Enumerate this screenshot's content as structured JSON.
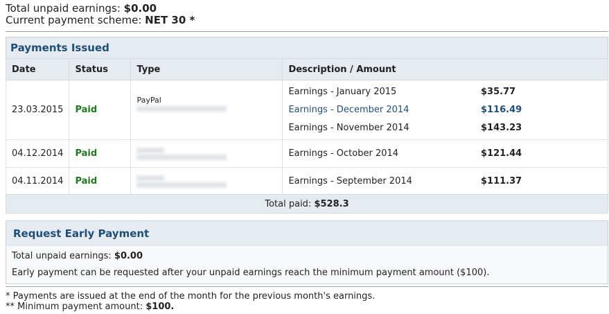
{
  "summary": {
    "unpaid_label": "Total unpaid earnings:",
    "unpaid_value": "$0.00",
    "scheme_label": "Current payment scheme:",
    "scheme_value": "NET 30 *"
  },
  "payments_issued": {
    "title": "Payments Issued",
    "columns": [
      "Date",
      "Status",
      "Type",
      "Description / Amount"
    ],
    "rows": [
      {
        "date": "23.03.2015",
        "status": "Paid",
        "type": "PayPal",
        "items": [
          {
            "desc": "Earnings - January 2015",
            "amount": "$35.77"
          },
          {
            "desc": "Earnings - December 2014",
            "amount": "$116.49"
          },
          {
            "desc": "Earnings - November 2014",
            "amount": "$143.23"
          }
        ]
      },
      {
        "date": "04.12.2014",
        "status": "Paid",
        "type": "",
        "items": [
          {
            "desc": "Earnings - October 2014",
            "amount": "$121.44"
          }
        ]
      },
      {
        "date": "04.11.2014",
        "status": "Paid",
        "type": "",
        "items": [
          {
            "desc": "Earnings - September 2014",
            "amount": "$111.37"
          }
        ]
      }
    ],
    "total_label": "Total paid:",
    "total_value": "$528.3"
  },
  "early_payment": {
    "title": "Request Early Payment",
    "unpaid_label": "Total unpaid earnings:",
    "unpaid_value": "$0.00",
    "note": "Early payment can be requested after your unpaid earnings reach the minimum payment amount ($100)."
  },
  "footnotes": {
    "note1": "* Payments are issued at the end of the month for the previous month's earnings.",
    "note2_label": "** Minimum payment amount:",
    "note2_value": "$100."
  },
  "colors": {
    "accent": "#1f4e79",
    "paid": "#1f7a1f",
    "panel_bg": "#e6ebf1"
  }
}
